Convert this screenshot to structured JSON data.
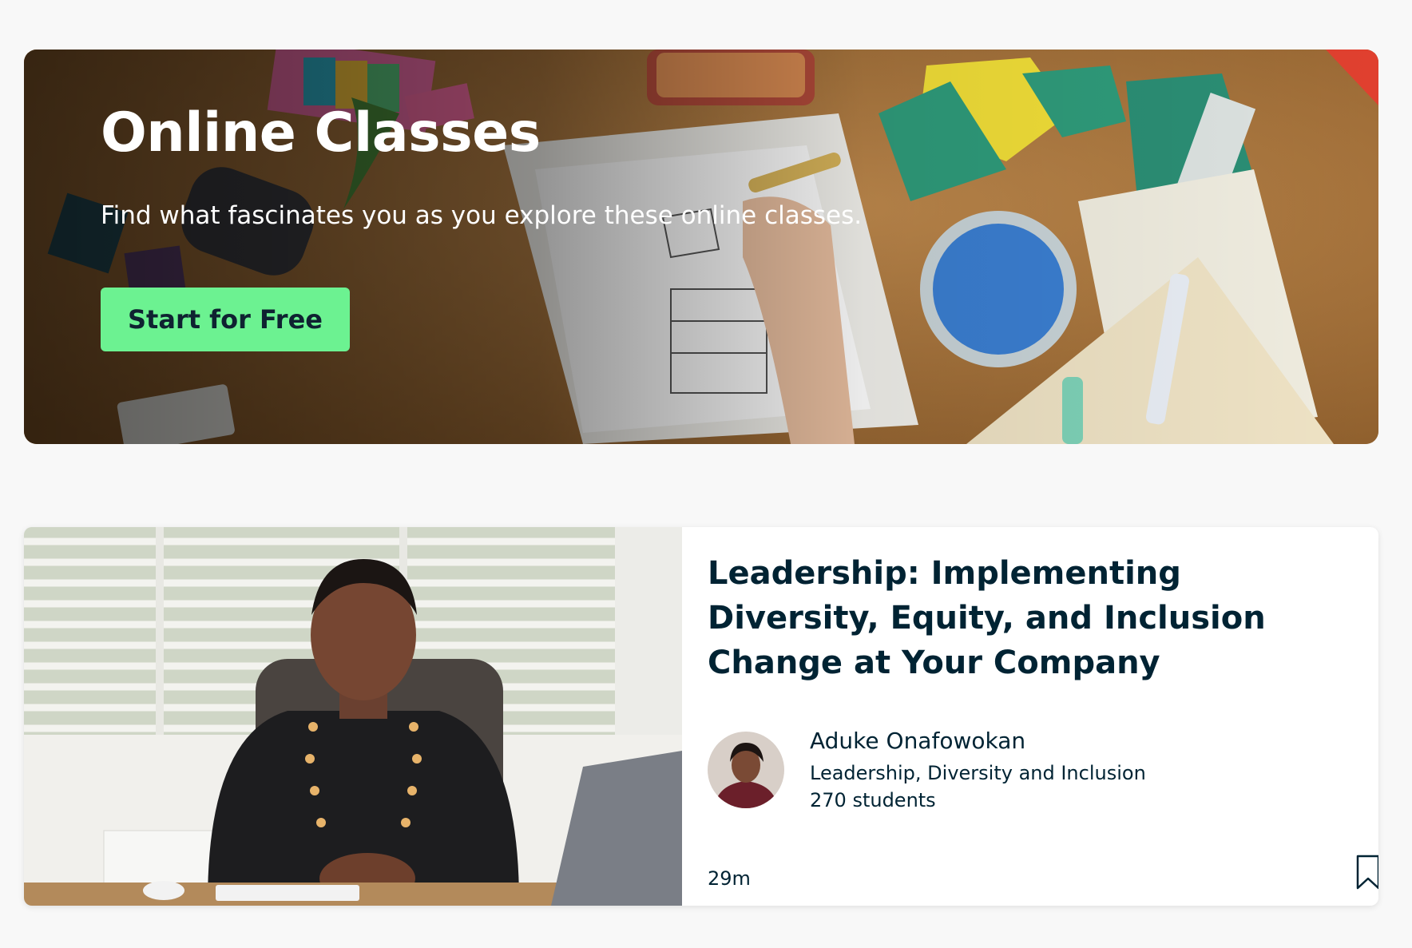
{
  "hero": {
    "title": "Online Classes",
    "subtitle": "Find what fascinates you as you explore these online classes.",
    "cta_label": "Start for Free",
    "cta_color": "#6cf291",
    "background_icon": "art-desk-illustration"
  },
  "featured_class": {
    "title": "Leadership: Implementing Diversity, Equity, and Inclusion Change at Your Company",
    "thumbnail_icon": "teacher-video-thumbnail",
    "teacher": {
      "name": "Aduke Onafowokan",
      "topic": "Leadership, Diversity and Inclusion",
      "students": "270 students",
      "avatar_icon": "teacher-avatar"
    },
    "duration": "29m",
    "bookmark_icon": "bookmark-icon",
    "text_color": "#002333"
  }
}
